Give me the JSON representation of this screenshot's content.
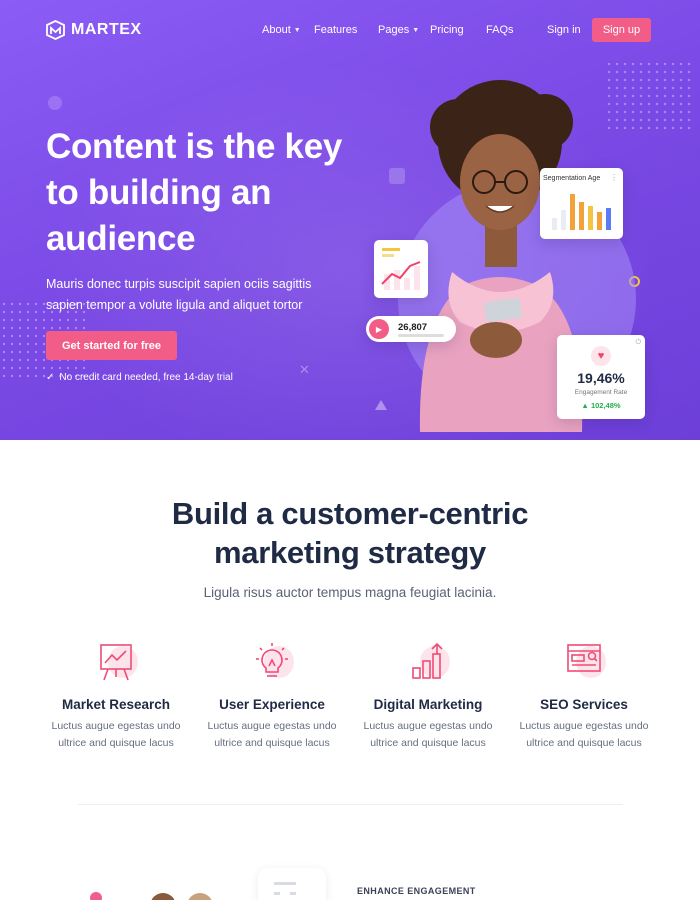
{
  "brand": {
    "name": "MARTEX",
    "accent": "#f25d87",
    "hero_bg": "#7c4ae6"
  },
  "nav": {
    "items": [
      {
        "label": "About",
        "has_caret": true
      },
      {
        "label": "Features",
        "has_caret": false
      },
      {
        "label": "Pages",
        "has_caret": true
      },
      {
        "label": "Pricing",
        "has_caret": false
      },
      {
        "label": "FAQs",
        "has_caret": false
      }
    ],
    "signin": "Sign in",
    "signup": "Sign up"
  },
  "hero": {
    "headline": "Content is the key to building an audience",
    "subtext": "Mauris donec turpis suscipit sapien ociis sagittis sapien tempor a volute ligula and aliquet tortor",
    "cta": "Get started for free",
    "note": "No credit card needed, free 14-day trial",
    "cards": {
      "age_title": "Segmentation Age",
      "play_count": "26,807",
      "engagement_value": "19,46%",
      "engagement_label": "Engagement Rate",
      "engagement_delta": "102,48%"
    }
  },
  "section": {
    "title_line1": "Build a customer-centric",
    "title_line2": "marketing strategy",
    "subtitle": "Ligula risus auctor tempus magna feugiat lacinia."
  },
  "features": [
    {
      "icon": "easel-chart-icon",
      "title": "Market Research",
      "line1": "Luctus augue egestas undo",
      "line2": "ultrice and quisque lacus"
    },
    {
      "icon": "lightbulb-icon",
      "title": "User Experience",
      "line1": "Luctus augue egestas undo",
      "line2": "ultrice and quisque lacus"
    },
    {
      "icon": "growth-bars-icon",
      "title": "Digital Marketing",
      "line1": "Luctus augue egestas undo",
      "line2": "ultrice and quisque lacus"
    },
    {
      "icon": "browser-search-icon",
      "title": "SEO Services",
      "line1": "Luctus augue egestas undo",
      "line2": "ultrice and quisque lacus"
    }
  ],
  "next_section": {
    "eyebrow": "ENHANCE ENGAGEMENT"
  }
}
